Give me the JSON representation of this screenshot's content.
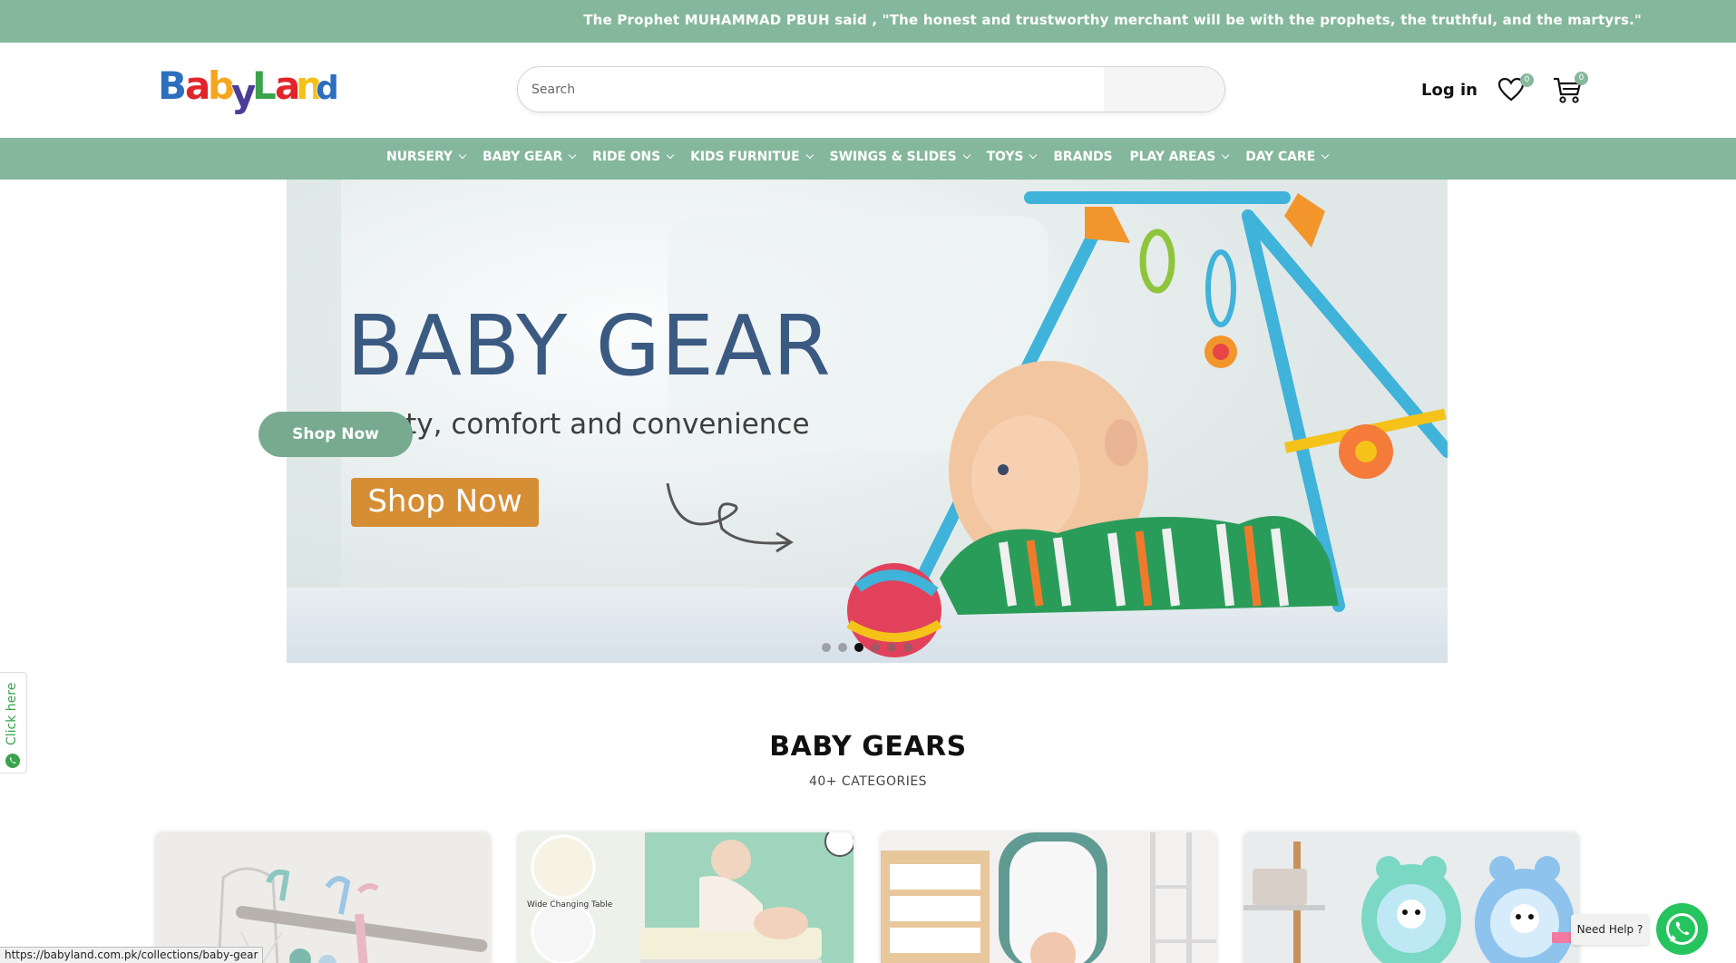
{
  "announcement": "The Prophet MUHAMMAD PBUH said , \"The honest and trustworthy merchant will be with the prophets, the truthful, and the martyrs.\"",
  "logo": {
    "text": "BabyLand"
  },
  "search": {
    "placeholder": "Search"
  },
  "header": {
    "login_label": "Log in",
    "wishlist_count": "0",
    "cart_count": "0"
  },
  "nav": {
    "items": [
      {
        "label": "NURSERY",
        "has_dropdown": true
      },
      {
        "label": "BABY GEAR",
        "has_dropdown": true
      },
      {
        "label": "RIDE ONS",
        "has_dropdown": true
      },
      {
        "label": "KIDS FURNITUE",
        "has_dropdown": true
      },
      {
        "label": "SWINGS & SLIDES",
        "has_dropdown": true
      },
      {
        "label": "TOYS",
        "has_dropdown": true
      },
      {
        "label": "BRANDS",
        "has_dropdown": false
      },
      {
        "label": "PLAY AREAS",
        "has_dropdown": true
      },
      {
        "label": "DAY CARE",
        "has_dropdown": true
      }
    ]
  },
  "hero": {
    "title": "BABY GEAR",
    "subtitle": "safety, comfort and convenience",
    "button_label": "Shop Now",
    "slide_count": 6,
    "active_slide": 3,
    "colors": {
      "title": "#3b5a82",
      "button": "#d68e35"
    }
  },
  "floating_shop_button": "Shop Now",
  "section": {
    "title": "BABY GEARS",
    "subtitle": "40+ CATEGORIES"
  },
  "cards": [
    {
      "name": "hanging-toys"
    },
    {
      "name": "changing-table",
      "caption": "Wide Changing Table"
    },
    {
      "name": "baby-bath"
    },
    {
      "name": "bath-toys"
    }
  ],
  "side_widget": {
    "label": "Click here"
  },
  "help": {
    "label": "Need Help ?"
  },
  "status_url": "https://babyland.com.pk/collections/baby-gear",
  "theme": {
    "accent": "#85b79c",
    "whatsapp": "#25c45e"
  }
}
